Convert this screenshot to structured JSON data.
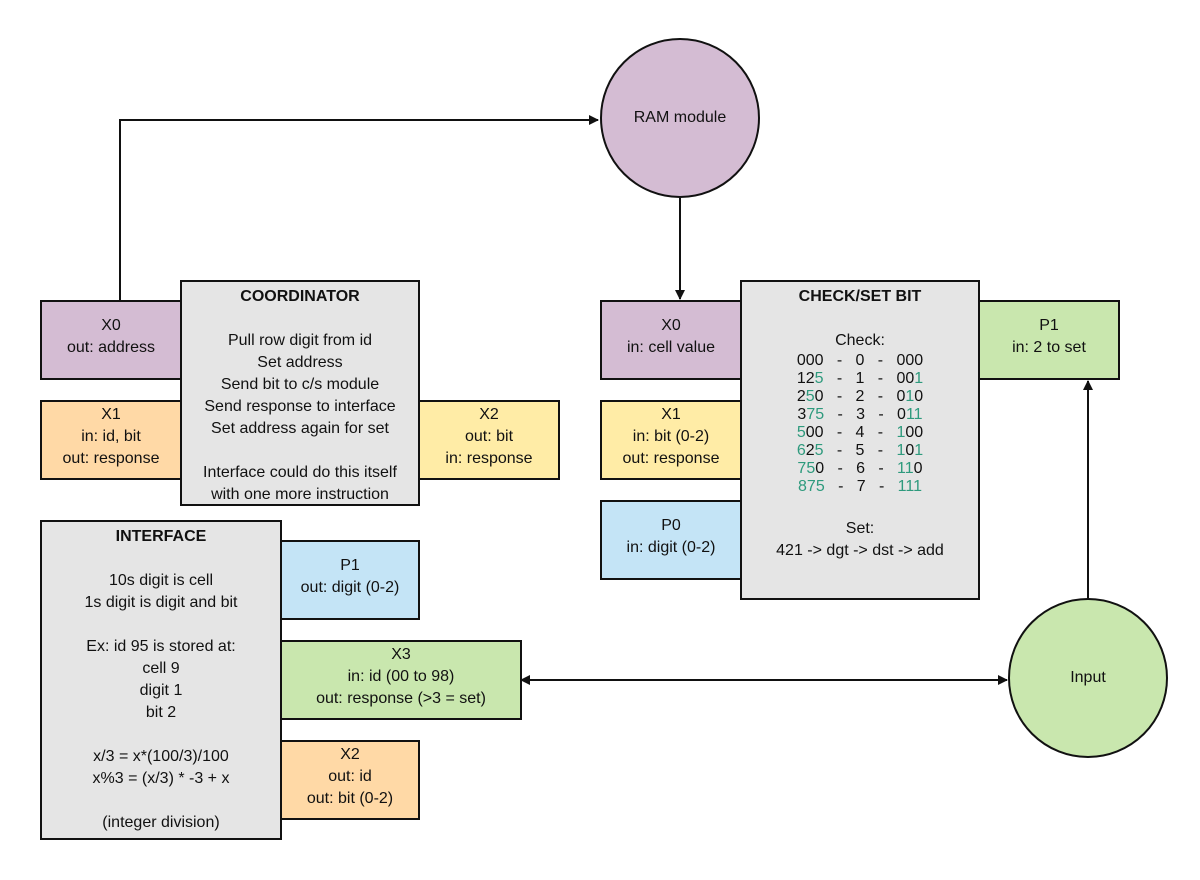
{
  "ram": {
    "label": "RAM module"
  },
  "input": {
    "label": "Input"
  },
  "coordinator": {
    "title": "COORDINATOR",
    "lines": [
      "Pull row digit from id",
      "Set address",
      "Send bit to c/s module",
      "Send response to interface",
      "Set address again for set"
    ],
    "note": [
      "Interface could do this itself",
      "with one more instruction"
    ],
    "ports": {
      "x0": {
        "name": "X0",
        "lines": [
          "out: address"
        ]
      },
      "x1": {
        "name": "X1",
        "lines": [
          "in: id, bit",
          "out: response"
        ]
      },
      "x2": {
        "name": "X2",
        "lines": [
          "out: bit",
          "in: response"
        ]
      }
    }
  },
  "interface": {
    "title": "INTERFACE",
    "lines": [
      "10s digit is cell",
      "1s digit is digit and bit"
    ],
    "example": [
      "Ex: id 95 is stored at:",
      "cell 9",
      "digit 1",
      "bit 2"
    ],
    "formulas": [
      "x/3 = x*(100/3)/100",
      "x%3 = (x/3) * -3 + x"
    ],
    "footnote": "(integer division)",
    "ports": {
      "p1": {
        "name": "P1",
        "lines": [
          "out: digit (0-2)"
        ]
      },
      "x3": {
        "name": "X3",
        "lines": [
          "in: id (00 to 98)",
          "out: response (>3 = set)"
        ]
      },
      "x2": {
        "name": "X2",
        "lines": [
          "out: id",
          "out: bit (0-2)"
        ]
      }
    }
  },
  "checkset": {
    "title": "CHECK/SET BIT",
    "check_label": "Check:",
    "rows": [
      {
        "dec": "000",
        "dec_mask": "000",
        "idx": "0",
        "bin": "000",
        "bin_mask": "000"
      },
      {
        "dec": "125",
        "dec_mask": "001",
        "idx": "1",
        "bin": "001",
        "bin_mask": "001"
      },
      {
        "dec": "250",
        "dec_mask": "010",
        "idx": "2",
        "bin": "010",
        "bin_mask": "010"
      },
      {
        "dec": "375",
        "dec_mask": "011",
        "idx": "3",
        "bin": "011",
        "bin_mask": "011"
      },
      {
        "dec": "500",
        "dec_mask": "100",
        "idx": "4",
        "bin": "100",
        "bin_mask": "100"
      },
      {
        "dec": "625",
        "dec_mask": "101",
        "idx": "5",
        "bin": "101",
        "bin_mask": "101"
      },
      {
        "dec": "750",
        "dec_mask": "110",
        "idx": "6",
        "bin": "110",
        "bin_mask": "110"
      },
      {
        "dec": "875",
        "dec_mask": "111",
        "idx": "7",
        "bin": "111",
        "bin_mask": "111"
      }
    ],
    "separator": "-",
    "set_label": "Set:",
    "set_line": "421 -> dgt -> dst -> add",
    "ports": {
      "x0": {
        "name": "X0",
        "lines": [
          "in: cell value"
        ]
      },
      "x1": {
        "name": "X1",
        "lines": [
          "in: bit (0-2)",
          "out: response"
        ]
      },
      "p0": {
        "name": "P0",
        "lines": [
          "in: digit (0-2)"
        ]
      },
      "p1": {
        "name": "P1",
        "lines": [
          "in: 2 to set"
        ]
      }
    }
  },
  "colors": {
    "highlight": "#2e9a7d",
    "purple": "#d4bcd3",
    "orange": "#ffd9a6",
    "yellow": "#ffeca6",
    "blue": "#c4e4f6",
    "green": "#c9e7ae",
    "gray": "#e5e5e5"
  }
}
